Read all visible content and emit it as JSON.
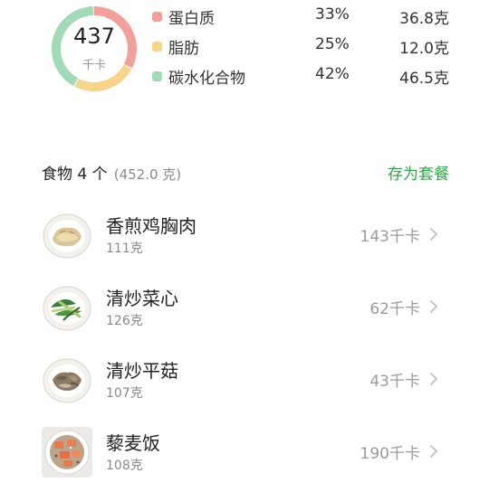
{
  "summary": {
    "calories": "437",
    "calories_unit": "千卡",
    "macros": [
      {
        "name": "蛋白质",
        "percent": "33%",
        "grams": "36.8克",
        "color": "#f4a09a"
      },
      {
        "name": "脂肪",
        "percent": "25%",
        "grams": "12.0克",
        "color": "#f8d48a"
      },
      {
        "name": "碳水化合物",
        "percent": "42%",
        "grams": "46.5克",
        "color": "#9fdcb6"
      }
    ]
  },
  "food_header": {
    "title": "食物 4 个",
    "weight": "(452.0 克)",
    "save_label": "存为套餐",
    "accent": "#2fa64a"
  },
  "foods": [
    {
      "name": "香煎鸡胸肉",
      "grams": "111克",
      "kcal": "143千卡",
      "icon": "chicken-breast-dish"
    },
    {
      "name": "清炒菜心",
      "grams": "126克",
      "kcal": "62千卡",
      "icon": "stir-fried-greens-dish"
    },
    {
      "name": "清炒平菇",
      "grams": "107克",
      "kcal": "43千卡",
      "icon": "oyster-mushroom-dish"
    },
    {
      "name": "藜麦饭",
      "grams": "108克",
      "kcal": "190千卡",
      "icon": "quinoa-rice-bowl"
    }
  ]
}
